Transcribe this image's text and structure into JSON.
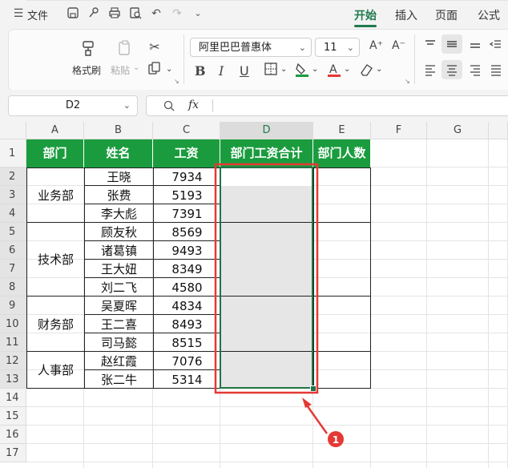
{
  "topbar": {
    "menu_label": "文件",
    "tabs": [
      "开始",
      "插入",
      "页面",
      "公式"
    ],
    "active_tab": "开始"
  },
  "ribbon": {
    "format_painter": "格式刷",
    "paste": "粘贴",
    "font_name": "阿里巴巴普惠体",
    "font_size": "11",
    "bold": "B",
    "italic": "I",
    "underline": "U",
    "grow_font": "A⁺",
    "shrink_font": "A⁻"
  },
  "formula_bar": {
    "name_box": "D2",
    "fx_label": "fx",
    "formula": ""
  },
  "sheet": {
    "columns": [
      "A",
      "B",
      "C",
      "D",
      "E",
      "F",
      "G"
    ],
    "rows": [
      "1",
      "2",
      "3",
      "4",
      "5",
      "6",
      "7",
      "8",
      "9",
      "10",
      "11",
      "12",
      "13",
      "14",
      "15",
      "16",
      "17"
    ],
    "headers": [
      "部门",
      "姓名",
      "工资",
      "部门工资合计",
      "部门人数"
    ],
    "departments": [
      "业务部",
      "技术部",
      "财务部",
      "人事部"
    ],
    "employees": [
      {
        "name": "王晓",
        "salary": "7934"
      },
      {
        "name": "张费",
        "salary": "5193"
      },
      {
        "name": "李大彪",
        "salary": "7391"
      },
      {
        "name": "顾友秋",
        "salary": "8569"
      },
      {
        "name": "诸葛镇",
        "salary": "9493"
      },
      {
        "name": "王大妞",
        "salary": "8349"
      },
      {
        "name": "刘二飞",
        "salary": "4580"
      },
      {
        "name": "吴夏晖",
        "salary": "4834"
      },
      {
        "name": "王二喜",
        "salary": "8493"
      },
      {
        "name": "司马懿",
        "salary": "8515"
      },
      {
        "name": "赵红霞",
        "salary": "7076"
      },
      {
        "name": "张二牛",
        "salary": "5314"
      }
    ]
  },
  "annotation": {
    "badge": "1"
  },
  "colors": {
    "header_green": "#1a9c3e",
    "accent": "#1f7a4d",
    "annotation_red": "#e53935",
    "selection_green": "#217346"
  }
}
